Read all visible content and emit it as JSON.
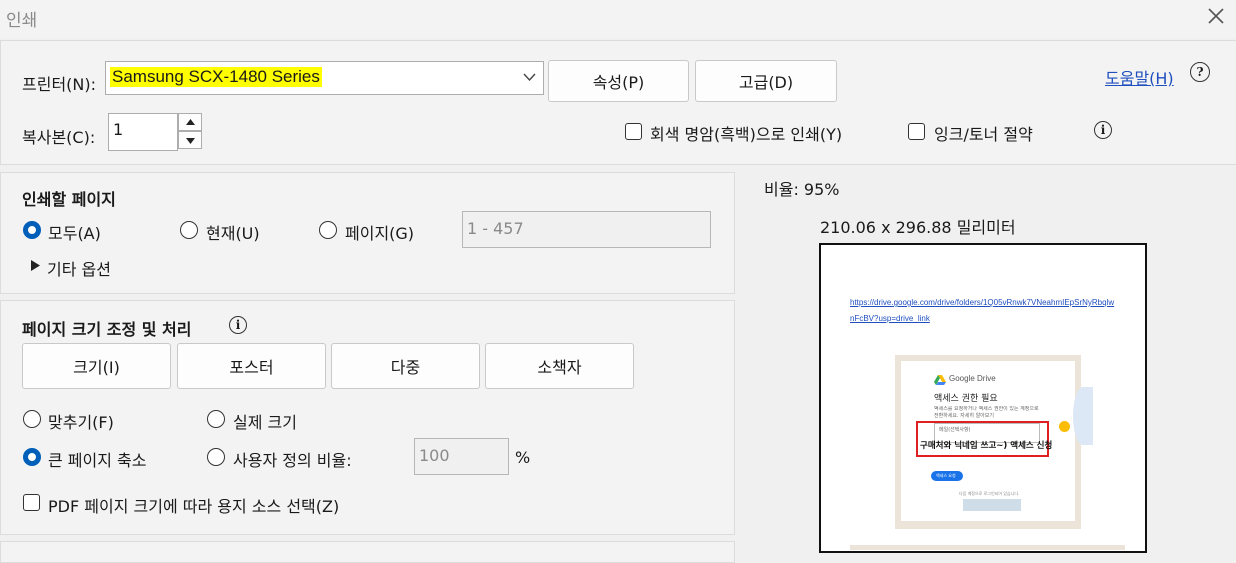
{
  "window": {
    "title": "인쇄",
    "close_icon": "close-icon"
  },
  "printer": {
    "label": "프린터(N):",
    "selected": "Samsung SCX-1480 Series",
    "properties_button": "속성(P)",
    "advanced_button": "고급(D)",
    "help_link": "도움말(H)"
  },
  "copies": {
    "label": "복사본(C):",
    "value": "1",
    "grayscale": {
      "label": "회색 명암(흑백)으로 인쇄(Y)",
      "checked": false
    },
    "save_ink": {
      "label": "잉크/토너 절약",
      "checked": false
    }
  },
  "pages": {
    "heading": "인쇄할 페이지",
    "all_label": "모두(A)",
    "current_label": "현재(U)",
    "pages_label": "페이지(G)",
    "selected": "all",
    "range_placeholder": "1 - 457",
    "more_options": "기타 옵션"
  },
  "sizing": {
    "heading": "페이지 크기 조정 및 처리",
    "tabs": [
      "크기(I)",
      "포스터",
      "다중",
      "소책자"
    ],
    "fit_label": "맞추기(F)",
    "actual_label": "실제 크기",
    "shrink_label": "큰 페이지 축소",
    "custom_label": "사용자 정의 비율:",
    "selected": "shrink",
    "custom_value": "100",
    "percent": "%",
    "pdf_source_label": "PDF 페이지 크기에 따라 용지 소스 선택(Z)",
    "pdf_source_checked": false
  },
  "preview": {
    "ratio": "비율:  95%",
    "dimensions": "210.06 x 296.88 밀리미터",
    "url_line1": "https://drive.google.com/drive/folders/1Q05vRnwk7VNeahmIEpSrNyRbqlw",
    "url_line2": "nFcBV?usp=drive_link",
    "gdrive_brand": "Google Drive",
    "access_title": "액세스 권한 필요",
    "access_body": "액세스를 요청하거나 액세스 권한이 있는 계정으로 전환하세요. 자세히 알아보기",
    "message_placeholder": "메일(선택사항)",
    "highlight_text": "구매처와 닉네임 쓰고~) 액세스 신청",
    "request_button": "액세스 요청",
    "signed_in_note": "다음 계정으로 로그인되어 있습니다.",
    "colors": {
      "accent": "#005fb8",
      "highlight": "#ffff00",
      "red_box": "#e02020",
      "link": "#1f4fbf"
    }
  }
}
